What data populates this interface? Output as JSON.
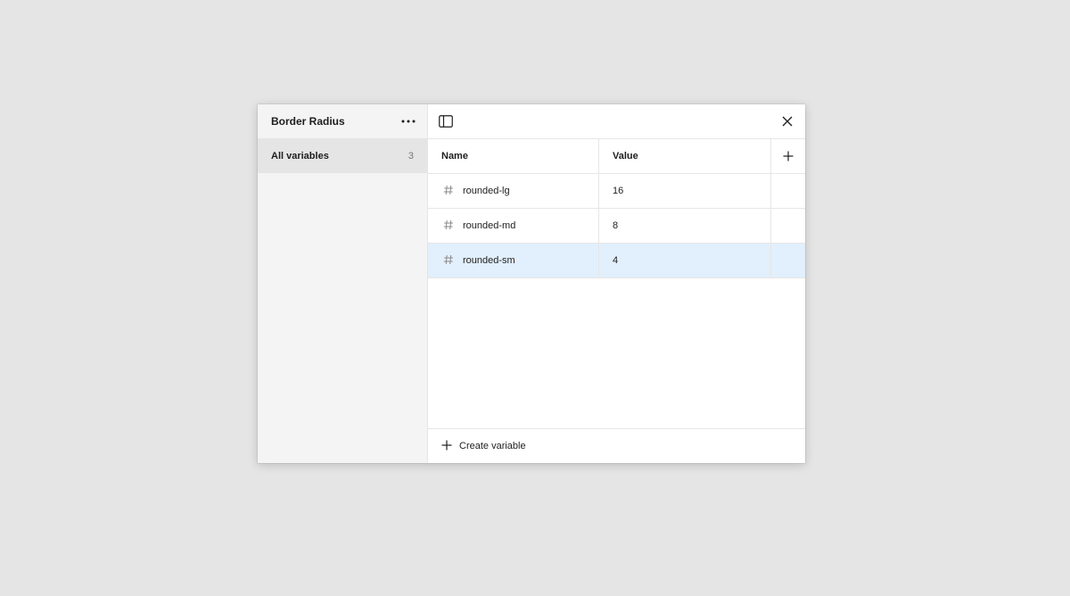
{
  "sidebar": {
    "collection_title": "Border Radius",
    "more_icon": "more-horizontal-icon",
    "items": [
      {
        "label": "All variables",
        "count": "3",
        "selected": true
      }
    ]
  },
  "toolbar": {
    "panel_icon": "sidebar-panel-icon",
    "close_icon": "close-icon"
  },
  "table": {
    "columns": [
      "Name",
      "Value"
    ],
    "add_column_icon": "plus-icon",
    "type_icon": "number-hash-icon",
    "rows": [
      {
        "name": "rounded-lg",
        "value": "16",
        "selected": false
      },
      {
        "name": "rounded-md",
        "value": "8",
        "selected": false
      },
      {
        "name": "rounded-sm",
        "value": "4",
        "selected": true
      }
    ]
  },
  "footer": {
    "create_label": "Create variable",
    "create_icon": "plus-icon"
  },
  "colors": {
    "selected_row": "#e2effc",
    "sidebar_bg": "#f4f4f4",
    "sidebar_selected": "#e5e5e5"
  }
}
